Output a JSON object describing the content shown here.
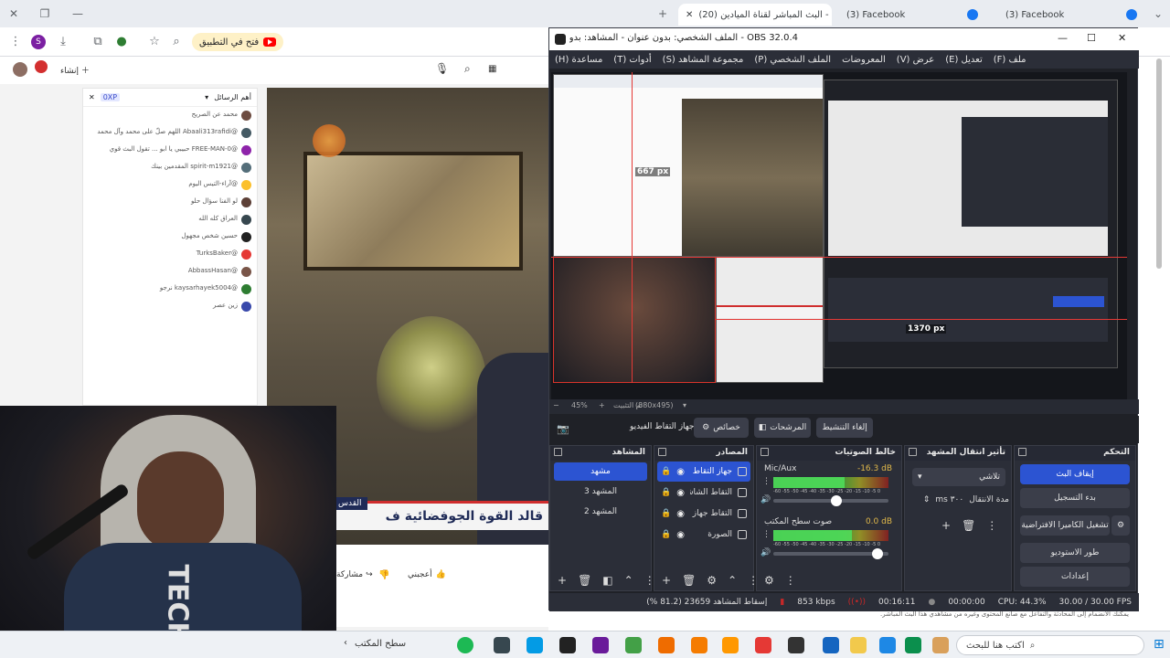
{
  "browser": {
    "tabs": [
      {
        "label": "(3) Facebook",
        "icon": "facebook-icon"
      },
      {
        "label": "(3) Facebook",
        "icon": "facebook-icon"
      },
      {
        "label": "(20) البث المباشر لقناة الميادين -",
        "icon": "youtube-icon"
      }
    ],
    "open_in_app": "فتح في التطبيق",
    "profile_initial": "S"
  },
  "youtube": {
    "chat_header": "أهم الرسائل",
    "chat_messages": [
      "محمد عن الصريح",
      "@Abaali313rafidi اللهم صلّ على محمد وآل محمد",
      "@FREE-MAN-0 حبيبي يا ابو ... تقول البث قوي",
      "@spirit-m1921 المقدمين بينك",
      "@آراء-التيس اليوم",
      "لو الفنا سؤال حلو",
      "العراق كله الله",
      "حسين شخص مجهول",
      "@TurksBaker",
      "@AbbassHasan",
      "@kaysarhayek5004 نرجو",
      "زين عصر"
    ],
    "video_caption": "قالد القوة الجوفضائية ف",
    "video_badge": "القدس",
    "like_label": "أعجبني",
    "share_label": "مشاركة",
    "comment_notice": "يمكنك الانضمام إلى المحادثة والتفاعل مع صانع المحتوى وغيره من مشاهدي هذا البث المباشر."
  },
  "obs": {
    "title": "OBS 32.0.4 - الملف الشخصي: بدون عنوان - المشاهد: بدون عنوان",
    "menu": [
      "ملف (F)",
      "تعديل (E)",
      "عرض (V)",
      "المعروضات",
      "الملف الشخصي (P)",
      "مجموعة المشاهد (S)",
      "أدوات (T)",
      "مساعدة (H)"
    ],
    "preview_zoom": "45%",
    "preview_resolution": "(880x495)",
    "preview_mode": "تم التثبيت",
    "measure_a": "667 px",
    "measure_b": "1370 px",
    "source_toolbar": {
      "source_name": "جهاز التقاط الفيديو",
      "properties": "خصائص",
      "filters": "المرشحات",
      "deactivate": "إلغاء التنشيط"
    },
    "docks": {
      "scenes": {
        "title": "المشاهد",
        "items": [
          "مشهد",
          "المشهد 3",
          "المشهد 2"
        ],
        "selected": 0
      },
      "sources": {
        "title": "المصادر",
        "items": [
          "جهاز التقاط الفيديو",
          "التقاط الشاشة 3",
          "التقاط جهاز الصوت",
          "الصورة"
        ],
        "selected": 0
      },
      "mixer": {
        "title": "خالط الصوتيات",
        "channels": [
          {
            "name": "Mic/Aux",
            "db": "-16.3 dB",
            "level": 0.62,
            "volume": 0.55
          },
          {
            "name": "صوت سطح المكتب",
            "db": "0.0 dB",
            "level": 0.68,
            "volume": 0.95
          }
        ],
        "meter_scale": "-60 -55 -50 -45 -40 -35 -30 -25 -20 -15 -10 -5 0"
      },
      "transitions": {
        "title": "تأثير انتقال المشهد",
        "type": "تلاشي",
        "duration_label": "مدة الانتقال",
        "duration": "٣٠٠ ms"
      },
      "controls": {
        "title": "التحكم",
        "buttons": [
          "إيقاف البث",
          "بدء التسجيل",
          "تشغيل الكاميرا الافتراضية",
          "طور الاستوديو",
          "إعدادات"
        ]
      }
    },
    "status": {
      "dropped": "إسقاط المشاهد 23659 (81.2 %)",
      "bitrate": "853 kbps",
      "live_time": "00:16:11",
      "rec_time": "00:00:00",
      "cpu": "CPU: 44.3%",
      "fps": "30.00 / 30.00 FPS"
    },
    "colors": {
      "accent": "#2c54d2",
      "bg": "#1f2127",
      "panel": "#2b2e38"
    }
  },
  "taskbar": {
    "search_placeholder": "اكتب هنا للبحث",
    "desktop_label": "سطح المكتب"
  }
}
